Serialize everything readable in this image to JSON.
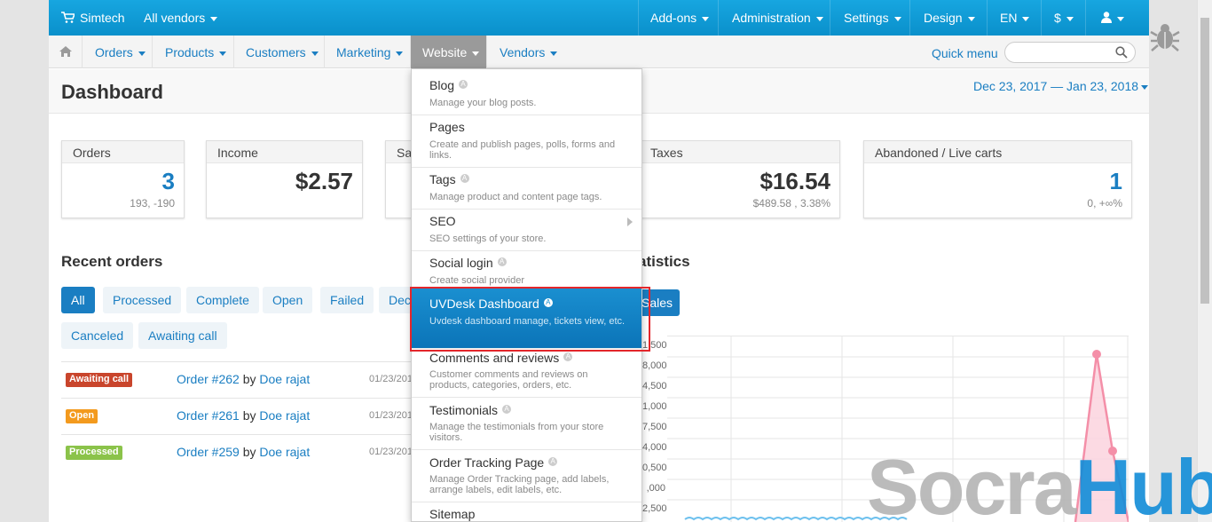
{
  "topbar": {
    "store": "Simtech",
    "vendors": "All vendors",
    "menus": [
      "Add-ons",
      "Administration",
      "Settings",
      "Design",
      "EN",
      "$"
    ]
  },
  "nav": {
    "items": [
      "Orders",
      "Products",
      "Customers",
      "Marketing",
      "Website",
      "Vendors"
    ],
    "active": "Website",
    "quick_menu": "Quick menu"
  },
  "header": {
    "title": "Dashboard",
    "date_range": "Dec 23, 2017 — Jan 23, 2018"
  },
  "cards": [
    {
      "label": "Orders",
      "value": "3",
      "sub": "193, -190"
    },
    {
      "label": "Income",
      "value": "$2.57",
      "sub": ""
    },
    {
      "label": "Sa",
      "value": "",
      "sub": ""
    },
    {
      "label": "Taxes",
      "value": "$16.54",
      "sub": "$489.58 , 3.38%"
    },
    {
      "label": "Abandoned / Live carts",
      "value": "1",
      "sub": "0, +∞%"
    }
  ],
  "recent_orders": {
    "title": "Recent orders",
    "filters": [
      "All",
      "Processed",
      "Complete",
      "Open",
      "Failed",
      "Dec",
      "Canceled",
      "Awaiting call"
    ],
    "rows": [
      {
        "status": "Awaiting call",
        "status_color": "#c9452c",
        "order": "Order #262",
        "by": "by",
        "customer": "Doe rajat",
        "date": "01/23/201"
      },
      {
        "status": "Open",
        "status_color": "#f39a1e",
        "order": "Order #261",
        "by": "by",
        "customer": "Doe rajat",
        "date": "01/23/201"
      },
      {
        "status": "Processed",
        "status_color": "#8bc34a",
        "order": "Order #259",
        "by": "by",
        "customer": "Doe rajat",
        "date": "01/23/201"
      }
    ]
  },
  "statistics": {
    "title_fragment": "atistics",
    "sales_button": "Sales",
    "y_ticks": [
      "1,500",
      "8,000",
      "4,500",
      "1,000",
      "7,500",
      "4,000",
      "0,500",
      ",000",
      "2,500"
    ]
  },
  "dropdown": {
    "items": [
      {
        "title": "Blog",
        "desc": "Manage your blog posts.",
        "addon": true
      },
      {
        "title": "Pages",
        "desc": "Create and publish pages, polls, forms and links.",
        "addon": false
      },
      {
        "title": "Tags",
        "desc": "Manage product and content page tags.",
        "addon": true
      },
      {
        "title": "SEO",
        "desc": "SEO settings of your store.",
        "addon": false,
        "submenu": true
      },
      {
        "title": "Social login",
        "desc": "Create social provider",
        "addon": true
      },
      {
        "title": "UVDesk Dashboard",
        "desc": "Uvdesk dashboard manage, tickets view, etc.",
        "addon": true,
        "highlighted": true
      },
      {
        "title": "Comments and reviews",
        "desc": "Customer comments and reviews on products, categories, orders, etc.",
        "addon": true
      },
      {
        "title": "Testimonials",
        "desc": "Manage the testimonials from your store visitors.",
        "addon": true
      },
      {
        "title": "Order Tracking Page",
        "desc": "Manage Order Tracking page, add labels, arrange labels, edit labels, etc.",
        "addon": true
      },
      {
        "title": "Sitemap",
        "desc": "",
        "addon": false
      }
    ],
    "addon_glyph": "A"
  },
  "watermark": {
    "part1": "Socra",
    "part2": "Hub"
  },
  "colors": {
    "accent": "#1a7ec2",
    "topbar": "#0a90cb",
    "highlight_border": "#e3262b",
    "chart_line": "#f48fa8"
  }
}
